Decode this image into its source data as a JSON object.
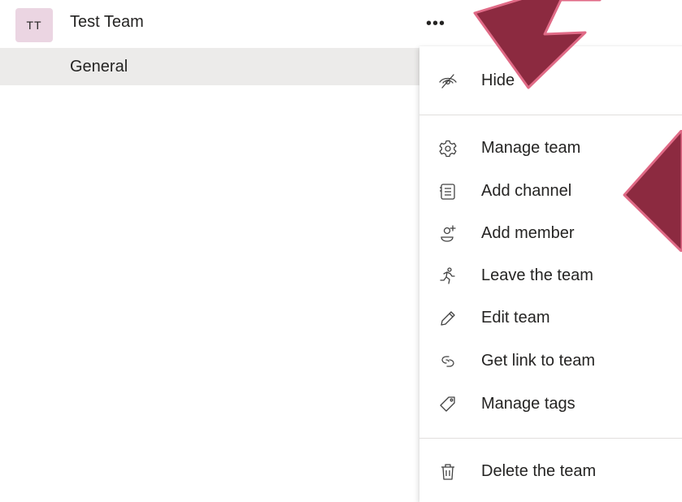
{
  "team": {
    "avatar_initials": "TT",
    "name": "Test Team",
    "more_label": "•••"
  },
  "channel": {
    "name": "General"
  },
  "menu": {
    "hide": "Hide",
    "manage_team": "Manage team",
    "add_channel": "Add channel",
    "add_member": "Add member",
    "leave_team": "Leave the team",
    "edit_team": "Edit team",
    "get_link": "Get link to team",
    "manage_tags": "Manage tags",
    "delete_team": "Delete the team"
  },
  "colors": {
    "arrow_fill": "#8c2a40",
    "arrow_outline": "#e06a86",
    "avatar_bg": "#ebd5e2",
    "selected_row_bg": "#ecebea"
  },
  "icons": {
    "hide": "eye-slash-icon",
    "manage_team": "gear-icon",
    "add_channel": "channel-list-icon",
    "add_member": "add-person-icon",
    "leave_team": "running-person-icon",
    "edit_team": "pencil-icon",
    "get_link": "link-icon",
    "manage_tags": "tag-icon",
    "delete_team": "trash-icon"
  }
}
